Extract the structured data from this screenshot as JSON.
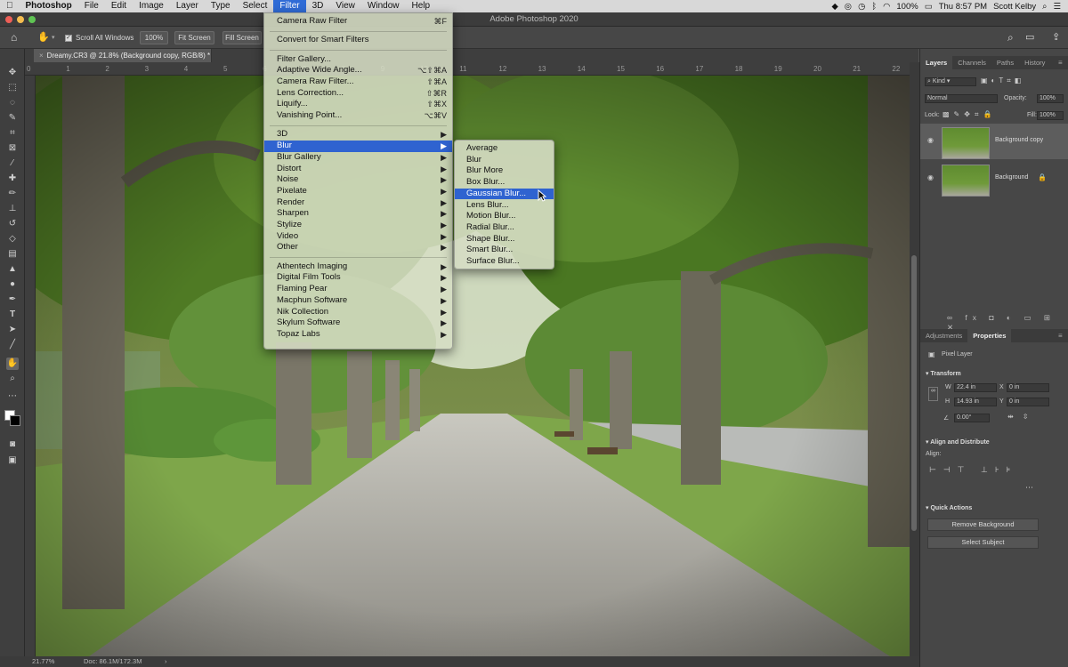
{
  "menubar": {
    "app": "Photoshop",
    "items": [
      "File",
      "Edit",
      "Image",
      "Layer",
      "Type",
      "Select",
      "Filter",
      "3D",
      "View",
      "Window",
      "Help"
    ],
    "active": "Filter",
    "status": {
      "battery": "100%",
      "clock": "Thu 8:57 PM",
      "user": "Scott Kelby"
    }
  },
  "window": {
    "title": "Adobe Photoshop 2020"
  },
  "options": {
    "scroll_all": "Scroll All Windows",
    "zoom_100": "100%",
    "fit_screen": "Fit Screen",
    "fill_screen": "Fill Screen"
  },
  "document": {
    "tab_title": "Dreamy.CR3 @ 21.8% (Background copy, RGB/8) *"
  },
  "ruler": {
    "top": [
      "0",
      "1",
      "2",
      "3",
      "4",
      "5",
      "6",
      "7",
      "8",
      "9",
      "10",
      "11",
      "12",
      "13",
      "14",
      "15",
      "16",
      "17",
      "18",
      "19",
      "20",
      "21",
      "22"
    ]
  },
  "statusbar": {
    "zoom": "21.77%",
    "doc": "Doc: 86.1M/172.3M"
  },
  "filter_menu": {
    "groups": [
      [
        {
          "label": "Camera Raw Filter",
          "shortcut": "⌘F"
        }
      ],
      [
        {
          "label": "Convert for Smart Filters",
          "shortcut": ""
        }
      ],
      [
        {
          "label": "Filter Gallery...",
          "shortcut": ""
        },
        {
          "label": "Adaptive Wide Angle...",
          "shortcut": "⌥⇧⌘A"
        },
        {
          "label": "Camera Raw Filter...",
          "shortcut": "⇧⌘A"
        },
        {
          "label": "Lens Correction...",
          "shortcut": "⇧⌘R"
        },
        {
          "label": "Liquify...",
          "shortcut": "⇧⌘X"
        },
        {
          "label": "Vanishing Point...",
          "shortcut": "⌥⌘V"
        }
      ],
      [
        {
          "label": "3D",
          "shortcut": "▶"
        },
        {
          "label": "Blur",
          "shortcut": "▶",
          "selected": true
        },
        {
          "label": "Blur Gallery",
          "shortcut": "▶"
        },
        {
          "label": "Distort",
          "shortcut": "▶"
        },
        {
          "label": "Noise",
          "shortcut": "▶"
        },
        {
          "label": "Pixelate",
          "shortcut": "▶"
        },
        {
          "label": "Render",
          "shortcut": "▶"
        },
        {
          "label": "Sharpen",
          "shortcut": "▶"
        },
        {
          "label": "Stylize",
          "shortcut": "▶"
        },
        {
          "label": "Video",
          "shortcut": "▶"
        },
        {
          "label": "Other",
          "shortcut": "▶"
        }
      ],
      [
        {
          "label": "Athentech Imaging",
          "shortcut": "▶"
        },
        {
          "label": "Digital Film Tools",
          "shortcut": "▶"
        },
        {
          "label": "Flaming Pear",
          "shortcut": "▶"
        },
        {
          "label": "Macphun Software",
          "shortcut": "▶"
        },
        {
          "label": "Nik Collection",
          "shortcut": "▶"
        },
        {
          "label": "Skylum Software",
          "shortcut": "▶"
        },
        {
          "label": "Topaz Labs",
          "shortcut": "▶"
        }
      ]
    ]
  },
  "blur_submenu": {
    "items": [
      "Average",
      "Blur",
      "Blur More",
      "Box Blur...",
      "Gaussian Blur...",
      "Lens Blur...",
      "Motion Blur...",
      "Radial Blur...",
      "Shape Blur...",
      "Smart Blur...",
      "Surface Blur..."
    ],
    "selected": "Gaussian Blur..."
  },
  "layers_panel": {
    "tabs": [
      "Layers",
      "Channels",
      "Paths",
      "History"
    ],
    "filter_kind": "Kind",
    "blend_mode": "Normal",
    "opacity_label": "Opacity:",
    "opacity": "100%",
    "lock_label": "Lock:",
    "fill_label": "Fill:",
    "fill": "100%",
    "layers": [
      {
        "name": "Background copy",
        "selected": true
      },
      {
        "name": "Background",
        "selected": false
      }
    ]
  },
  "properties_panel": {
    "tabs": [
      "Adjustments",
      "Properties"
    ],
    "layer_type": "Pixel Layer",
    "transform_title": "Transform",
    "w_label": "W",
    "w": "22.4 in",
    "h_label": "H",
    "h": "14.93 in",
    "x_label": "X",
    "x": "0 in",
    "y_label": "Y",
    "y": "0 in",
    "angle": "0.00°",
    "align_title": "Align and Distribute",
    "align_label": "Align:",
    "quick_actions_title": "Quick Actions",
    "remove_bg": "Remove Background",
    "select_subject": "Select Subject"
  },
  "colors": {
    "accent": "#2f63d0",
    "panel": "#474747",
    "menu": "#d6ddc4"
  }
}
